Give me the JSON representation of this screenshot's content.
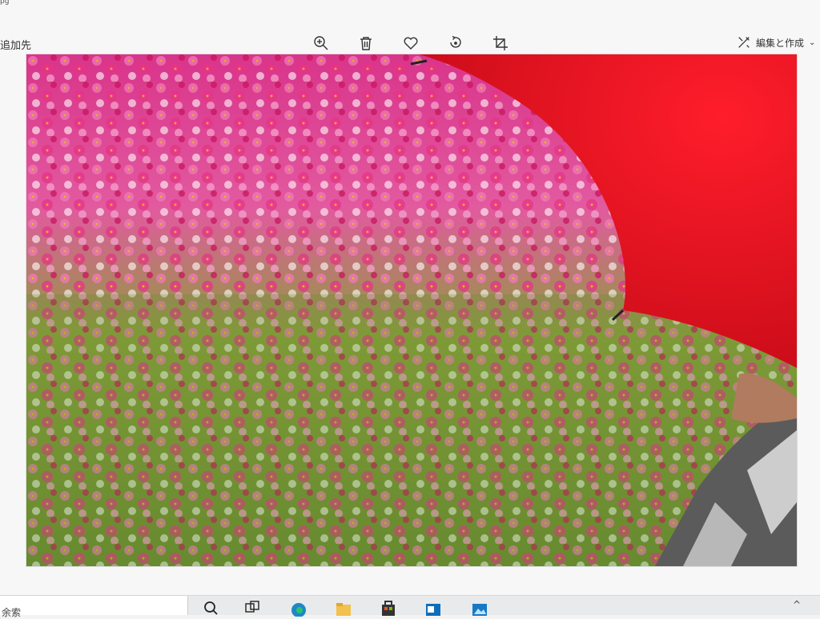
{
  "window": {
    "title_fragment": "pg"
  },
  "toolbar": {
    "add_to_label": "追加先",
    "zoom_icon": "zoom-in-icon",
    "delete_icon": "trash-icon",
    "favorite_icon": "heart-icon",
    "rotate_icon": "rotate-icon",
    "crop_icon": "crop-icon",
    "edit_create_label": "編集と作成"
  },
  "photo": {
    "subject_colors": {
      "umbrella": "#e3141f",
      "flowers": "#e0468c",
      "grass": "#5a8a2e"
    }
  },
  "taskbar": {
    "search_partial_text": "余索",
    "icons": [
      "search-icon",
      "task-view-icon",
      "edge-icon",
      "file-explorer-icon",
      "store-icon",
      "mail-icon",
      "photos-icon"
    ],
    "tray_chevron": "^"
  }
}
